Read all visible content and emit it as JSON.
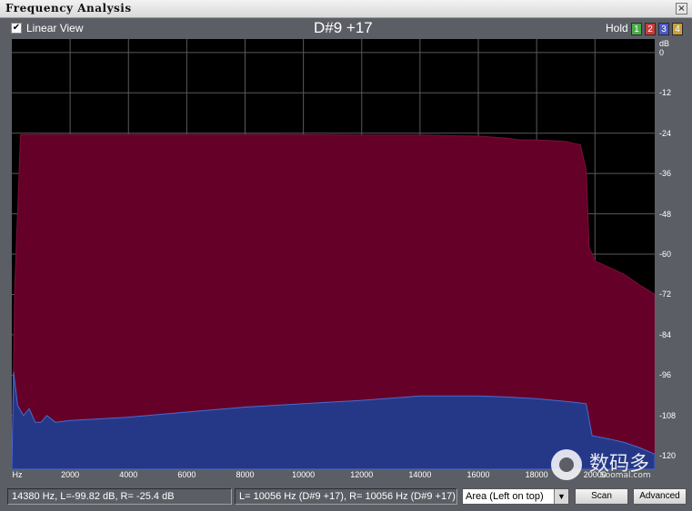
{
  "window": {
    "title": "Frequency Analysis",
    "close_glyph": "×"
  },
  "toolbar": {
    "linear_view_checked": true,
    "linear_view_label": "Linear View",
    "note_display": "D#9 +17",
    "hold_label": "Hold",
    "hold_buttons": [
      {
        "label": "1",
        "color": "#4caa4c"
      },
      {
        "label": "2",
        "color": "#c83c3c"
      },
      {
        "label": "3",
        "color": "#4c5ac8"
      },
      {
        "label": "4",
        "color": "#c8a03c"
      }
    ]
  },
  "chart_data": {
    "type": "area",
    "xlabel": "Hz",
    "ylabel": "dB",
    "xlim": [
      0,
      22050
    ],
    "ylim": [
      -124,
      4
    ],
    "x_ticks": [
      "Hz",
      "2000",
      "4000",
      "6000",
      "8000",
      "10000",
      "12000",
      "14000",
      "16000",
      "18000",
      "20000"
    ],
    "y_ticks": [
      "dB",
      "0",
      "-12",
      "-24",
      "-36",
      "-48",
      "-60",
      "-72",
      "-84",
      "-96",
      "-108",
      "-120"
    ],
    "grid": true,
    "series": [
      {
        "color": "#650028",
        "x": [
          0,
          100,
          300,
          1000,
          3000,
          6000,
          9000,
          12000,
          14000,
          16000,
          17000,
          17400,
          18000,
          19000,
          19500,
          19700,
          19800,
          20000,
          20500,
          21000,
          21500,
          22050
        ],
        "values": [
          -124,
          -70,
          -24.5,
          -24.4,
          -24.4,
          -24.4,
          -24.4,
          -24.6,
          -24.6,
          -24.9,
          -25.5,
          -26.0,
          -26.0,
          -26.5,
          -27.5,
          -35,
          -58,
          -62,
          -64,
          -66,
          -69,
          -72
        ]
      },
      {
        "color": "#253888",
        "x": [
          0,
          60,
          200,
          400,
          600,
          800,
          1000,
          1200,
          1500,
          2000,
          3000,
          4000,
          6000,
          8000,
          10000,
          12000,
          14000,
          15000,
          16000,
          17000,
          18000,
          19000,
          19700,
          19900,
          20500,
          21000,
          21500,
          22050
        ],
        "values": [
          -124,
          -95,
          -105,
          -108,
          -106,
          -110,
          -110,
          -108,
          -110,
          -109.5,
          -109,
          -108.5,
          -107,
          -105.5,
          -104.5,
          -103.5,
          -102.2,
          -102.2,
          -102.2,
          -102.5,
          -103,
          -103.8,
          -104.5,
          -114,
          -115,
          -116,
          -117.5,
          -119.5
        ]
      }
    ]
  },
  "status": {
    "cursor_readout": "14380 Hz, L=-99.82 dB, R= -25.4 dB",
    "peak_readout": "L=  10056 Hz (D#9 +17), R=  10056 Hz (D#9 +17)",
    "display_mode": "Area (Left on top)",
    "scan_label": "Scan",
    "advanced_label": "Advanced"
  },
  "watermark": {
    "brand": "数码多",
    "url": "Soomal.com"
  }
}
